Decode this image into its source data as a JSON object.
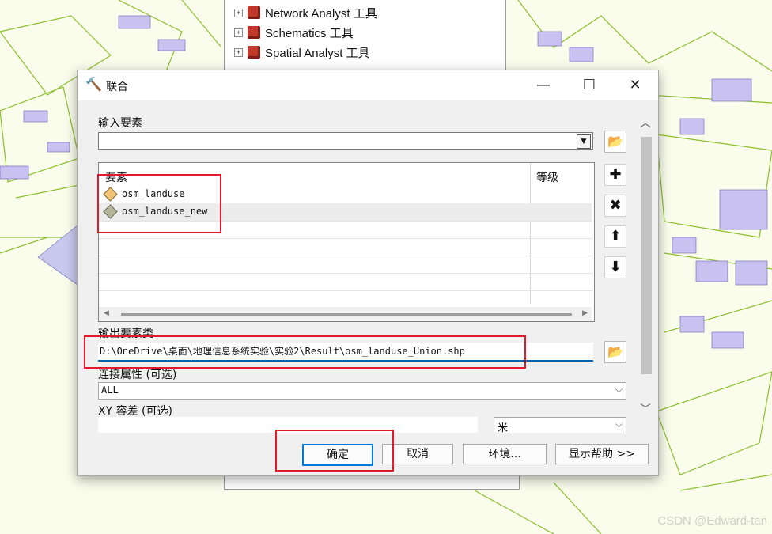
{
  "tree": {
    "items": [
      {
        "label": "Network Analyst 工具"
      },
      {
        "label": "Schematics 工具"
      },
      {
        "label": "Spatial Analyst 工具"
      }
    ]
  },
  "dialog": {
    "title": "联合",
    "input_features_label": "输入要素",
    "input_features_value": "",
    "table": {
      "col_feature": "要素",
      "col_rank": "等级",
      "rows": [
        {
          "name": "osm_landuse",
          "rank": ""
        },
        {
          "name": "osm_landuse_new",
          "rank": ""
        }
      ]
    },
    "output_label": "输出要素类",
    "output_value": "D:\\OneDrive\\桌面\\地理信息系统实验\\实验2\\Result\\osm_landuse_Union.shp",
    "join_attr_label": "连接属性 (可选)",
    "join_attr_value": "ALL",
    "xy_tolerance_label": "XY 容差 (可选)",
    "xy_tolerance_value": "",
    "xy_unit_value": "米",
    "buttons": {
      "ok": "确定",
      "cancel": "取消",
      "env": "环境...",
      "help": "显示帮助 >>"
    }
  },
  "watermark": "CSDN @Edward-tan",
  "colors": {
    "accent": "#0078d7",
    "annotation": "#e0192b",
    "map_line": "#8bbf2c",
    "building": "#c9c1f0"
  }
}
